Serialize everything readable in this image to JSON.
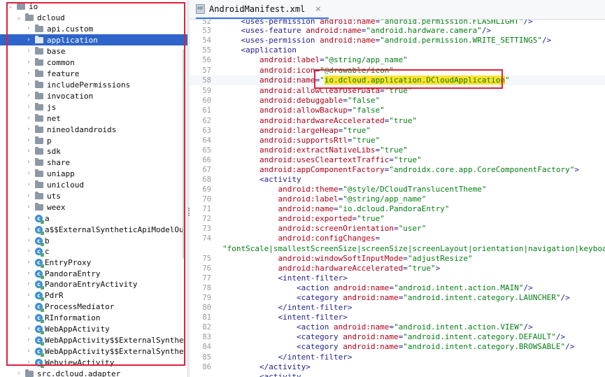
{
  "tree": {
    "items": [
      {
        "chev": "⌄",
        "icon": "folder",
        "label": "io"
      },
      {
        "chev": "⌄",
        "icon": "folder",
        "label": "dcloud"
      },
      {
        "chev": "›",
        "icon": "folder",
        "label": "api.custom"
      },
      {
        "chev": "›",
        "icon": "folder",
        "label": "application",
        "selected": true
      },
      {
        "chev": "›",
        "icon": "folder",
        "label": "base"
      },
      {
        "chev": "›",
        "icon": "folder",
        "label": "common"
      },
      {
        "chev": "›",
        "icon": "folder",
        "label": "feature"
      },
      {
        "chev": "›",
        "icon": "folder",
        "label": "includePermissions"
      },
      {
        "chev": "›",
        "icon": "folder",
        "label": "invocation"
      },
      {
        "chev": "›",
        "icon": "folder",
        "label": "js"
      },
      {
        "chev": "›",
        "icon": "folder",
        "label": "net"
      },
      {
        "chev": "›",
        "icon": "folder",
        "label": "nineoldandroids"
      },
      {
        "chev": "›",
        "icon": "folder",
        "label": "p"
      },
      {
        "chev": "›",
        "icon": "folder",
        "label": "sdk"
      },
      {
        "chev": "›",
        "icon": "folder",
        "label": "share"
      },
      {
        "chev": "›",
        "icon": "folder",
        "label": "uniapp"
      },
      {
        "chev": "›",
        "icon": "folder",
        "label": "unicloud"
      },
      {
        "chev": "›",
        "icon": "folder",
        "label": "uts"
      },
      {
        "chev": "›",
        "icon": "folder",
        "label": "weex"
      },
      {
        "chev": "›",
        "icon": "class",
        "label": "a"
      },
      {
        "chev": "›",
        "icon": "class",
        "label": "a$$ExternalSyntheticApiModelOu"
      },
      {
        "chev": "›",
        "icon": "class",
        "label": "b"
      },
      {
        "chev": "›",
        "icon": "class",
        "label": "c"
      },
      {
        "chev": "›",
        "icon": "class",
        "label": "EntryProxy"
      },
      {
        "chev": "›",
        "icon": "class",
        "label": "PandoraEntry"
      },
      {
        "chev": "›",
        "icon": "class",
        "label": "PandoraEntryActivity"
      },
      {
        "chev": "›",
        "icon": "class",
        "label": "PdrR"
      },
      {
        "chev": "›",
        "icon": "class",
        "label": "ProcessMediator"
      },
      {
        "chev": "›",
        "icon": "class",
        "label": "RInformation"
      },
      {
        "chev": "›",
        "icon": "class",
        "label": "WebAppActivity"
      },
      {
        "chev": "›",
        "icon": "class",
        "label": "WebAppActivity$$ExternalSynthe"
      },
      {
        "chev": "›",
        "icon": "class",
        "label": "WebAppActivity$$ExternalSynthe"
      },
      {
        "chev": "›",
        "icon": "class",
        "label": "WebviewActivity"
      },
      {
        "chev": "›",
        "icon": "folder",
        "label": "src.dcloud.adapter"
      }
    ]
  },
  "tab": {
    "icon_text": "MF",
    "label": "AndroidManifest.xml",
    "close": "×"
  },
  "code_lines": [
    {
      "num": "52",
      "indent": "    ",
      "parts": [
        [
          "t",
          "<uses-permission "
        ],
        [
          "a",
          "android:name"
        ],
        [
          "p",
          "="
        ],
        [
          "v",
          "\"android.permission.FLASHLIGHT\""
        ],
        [
          "t",
          "/>"
        ]
      ]
    },
    {
      "num": "53",
      "indent": "    ",
      "parts": [
        [
          "t",
          "<uses-feature "
        ],
        [
          "a",
          "android:name"
        ],
        [
          "p",
          "="
        ],
        [
          "v",
          "\"android.hardware.camera\""
        ],
        [
          "t",
          "/>"
        ]
      ]
    },
    {
      "num": "54",
      "indent": "    ",
      "parts": [
        [
          "t",
          "<uses-permission "
        ],
        [
          "a",
          "android:name"
        ],
        [
          "p",
          "="
        ],
        [
          "v",
          "\"android.permission.WRITE_SETTINGS\""
        ],
        [
          "t",
          "/>"
        ]
      ]
    },
    {
      "num": "55",
      "indent": "    ",
      "parts": [
        [
          "t",
          "<application"
        ]
      ]
    },
    {
      "num": "56",
      "indent": "        ",
      "parts": [
        [
          "a",
          "android:label"
        ],
        [
          "p",
          "="
        ],
        [
          "v",
          "\"@string/app_name\""
        ]
      ]
    },
    {
      "num": "57",
      "indent": "        ",
      "parts": [
        [
          "a",
          "android:icon"
        ],
        [
          "p",
          "="
        ],
        [
          "v",
          "\"@drawable/icon\""
        ]
      ]
    },
    {
      "num": "58",
      "indent": "        ",
      "parts": [
        [
          "a",
          "android:name"
        ],
        [
          "p",
          "="
        ],
        [
          "v",
          "\""
        ],
        [
          "vh",
          "io.dcloud.application.DCloudApplication"
        ],
        [
          "v",
          "\""
        ]
      ]
    },
    {
      "num": "59",
      "indent": "        ",
      "parts": [
        [
          "a",
          "android:allowClearUserData"
        ],
        [
          "p",
          "="
        ],
        [
          "v",
          "\"true\""
        ]
      ]
    },
    {
      "num": "60",
      "indent": "        ",
      "parts": [
        [
          "a",
          "android:debuggable"
        ],
        [
          "p",
          "="
        ],
        [
          "v",
          "\"false\""
        ]
      ]
    },
    {
      "num": "61",
      "indent": "        ",
      "parts": [
        [
          "a",
          "android:allowBackup"
        ],
        [
          "p",
          "="
        ],
        [
          "v",
          "\"false\""
        ]
      ]
    },
    {
      "num": "62",
      "indent": "        ",
      "parts": [
        [
          "a",
          "android:hardwareAccelerated"
        ],
        [
          "p",
          "="
        ],
        [
          "v",
          "\"true\""
        ]
      ]
    },
    {
      "num": "63",
      "indent": "        ",
      "parts": [
        [
          "a",
          "android:largeHeap"
        ],
        [
          "p",
          "="
        ],
        [
          "v",
          "\"true\""
        ]
      ]
    },
    {
      "num": "64",
      "indent": "        ",
      "parts": [
        [
          "a",
          "android:supportsRtl"
        ],
        [
          "p",
          "="
        ],
        [
          "v",
          "\"true\""
        ]
      ]
    },
    {
      "num": "65",
      "indent": "        ",
      "parts": [
        [
          "a",
          "android:extractNativeLibs"
        ],
        [
          "p",
          "="
        ],
        [
          "v",
          "\"true\""
        ]
      ]
    },
    {
      "num": "66",
      "indent": "        ",
      "parts": [
        [
          "a",
          "android:usesCleartextTraffic"
        ],
        [
          "p",
          "="
        ],
        [
          "v",
          "\"true\""
        ]
      ]
    },
    {
      "num": "67",
      "indent": "        ",
      "parts": [
        [
          "a",
          "android:appComponentFactory"
        ],
        [
          "p",
          "="
        ],
        [
          "v",
          "\"androidx.core.app.CoreComponentFactory\""
        ],
        [
          "t",
          ">"
        ]
      ]
    },
    {
      "num": "68",
      "indent": "        ",
      "parts": [
        [
          "t",
          "<activity"
        ]
      ]
    },
    {
      "num": "69",
      "indent": "            ",
      "parts": [
        [
          "a",
          "android:theme"
        ],
        [
          "p",
          "="
        ],
        [
          "v",
          "\"@style/DCloudTranslucentTheme\""
        ]
      ]
    },
    {
      "num": "70",
      "indent": "            ",
      "parts": [
        [
          "a",
          "android:label"
        ],
        [
          "p",
          "="
        ],
        [
          "v",
          "\"@string/app_name\""
        ]
      ]
    },
    {
      "num": "71",
      "indent": "            ",
      "parts": [
        [
          "a",
          "android:name"
        ],
        [
          "p",
          "="
        ],
        [
          "v",
          "\"io.dcloud.PandoraEntry\""
        ]
      ]
    },
    {
      "num": "72",
      "indent": "            ",
      "parts": [
        [
          "a",
          "android:exported"
        ],
        [
          "p",
          "="
        ],
        [
          "v",
          "\"true\""
        ]
      ]
    },
    {
      "num": "73",
      "indent": "            ",
      "parts": [
        [
          "a",
          "android:screenOrientation"
        ],
        [
          "p",
          "="
        ],
        [
          "v",
          "\"user\""
        ]
      ]
    },
    {
      "num": "74",
      "indent": "            ",
      "parts": [
        [
          "a",
          "android:configChanges"
        ],
        [
          "p",
          "="
        ]
      ]
    },
    {
      "num": "",
      "wrap": true,
      "indent": "",
      "parts": [
        [
          "v",
          "\"fontScale|smallestScreenSize|screenSize|screenLayout|orientation|navigation|keyboardH"
        ]
      ]
    },
    {
      "num": "75",
      "indent": "            ",
      "parts": [
        [
          "a",
          "android:windowSoftInputMode"
        ],
        [
          "p",
          "="
        ],
        [
          "v",
          "\"adjustResize\""
        ]
      ]
    },
    {
      "num": "76",
      "indent": "            ",
      "parts": [
        [
          "a",
          "android:hardwareAccelerated"
        ],
        [
          "p",
          "="
        ],
        [
          "v",
          "\"true\""
        ],
        [
          "t",
          ">"
        ]
      ]
    },
    {
      "num": "77",
      "indent": "            ",
      "parts": [
        [
          "t",
          "<intent-filter>"
        ]
      ]
    },
    {
      "num": "78",
      "indent": "                ",
      "parts": [
        [
          "t",
          "<action "
        ],
        [
          "a",
          "android:name"
        ],
        [
          "p",
          "="
        ],
        [
          "v",
          "\"android.intent.action.MAIN\""
        ],
        [
          "t",
          "/>"
        ]
      ]
    },
    {
      "num": "79",
      "indent": "                ",
      "parts": [
        [
          "t",
          "<category "
        ],
        [
          "a",
          "android:name"
        ],
        [
          "p",
          "="
        ],
        [
          "v",
          "\"android.intent.category.LAUNCHER\""
        ],
        [
          "t",
          "/>"
        ]
      ]
    },
    {
      "num": "80",
      "indent": "            ",
      "parts": [
        [
          "t",
          "</intent-filter>"
        ]
      ]
    },
    {
      "num": "81",
      "indent": "            ",
      "parts": [
        [
          "t",
          "<intent-filter>"
        ]
      ]
    },
    {
      "num": "82",
      "indent": "                ",
      "parts": [
        [
          "t",
          "<action "
        ],
        [
          "a",
          "android:name"
        ],
        [
          "p",
          "="
        ],
        [
          "v",
          "\"android.intent.action.VIEW\""
        ],
        [
          "t",
          "/>"
        ]
      ]
    },
    {
      "num": "83",
      "indent": "                ",
      "parts": [
        [
          "t",
          "<category "
        ],
        [
          "a",
          "android:name"
        ],
        [
          "p",
          "="
        ],
        [
          "v",
          "\"android.intent.category.DEFAULT\""
        ],
        [
          "t",
          "/>"
        ]
      ]
    },
    {
      "num": "84",
      "indent": "                ",
      "parts": [
        [
          "t",
          "<category "
        ],
        [
          "a",
          "android:name"
        ],
        [
          "p",
          "="
        ],
        [
          "v",
          "\"android.intent.category.BROWSABLE\""
        ],
        [
          "t",
          "/>"
        ]
      ]
    },
    {
      "num": "85",
      "indent": "            ",
      "parts": [
        [
          "t",
          "</intent-filter>"
        ]
      ]
    },
    {
      "num": "86",
      "indent": "        ",
      "parts": [
        [
          "t",
          "</activity>"
        ]
      ]
    },
    {
      "num": "",
      "indent": "        ",
      "parts": [
        [
          "t",
          "<activity"
        ]
      ]
    }
  ]
}
